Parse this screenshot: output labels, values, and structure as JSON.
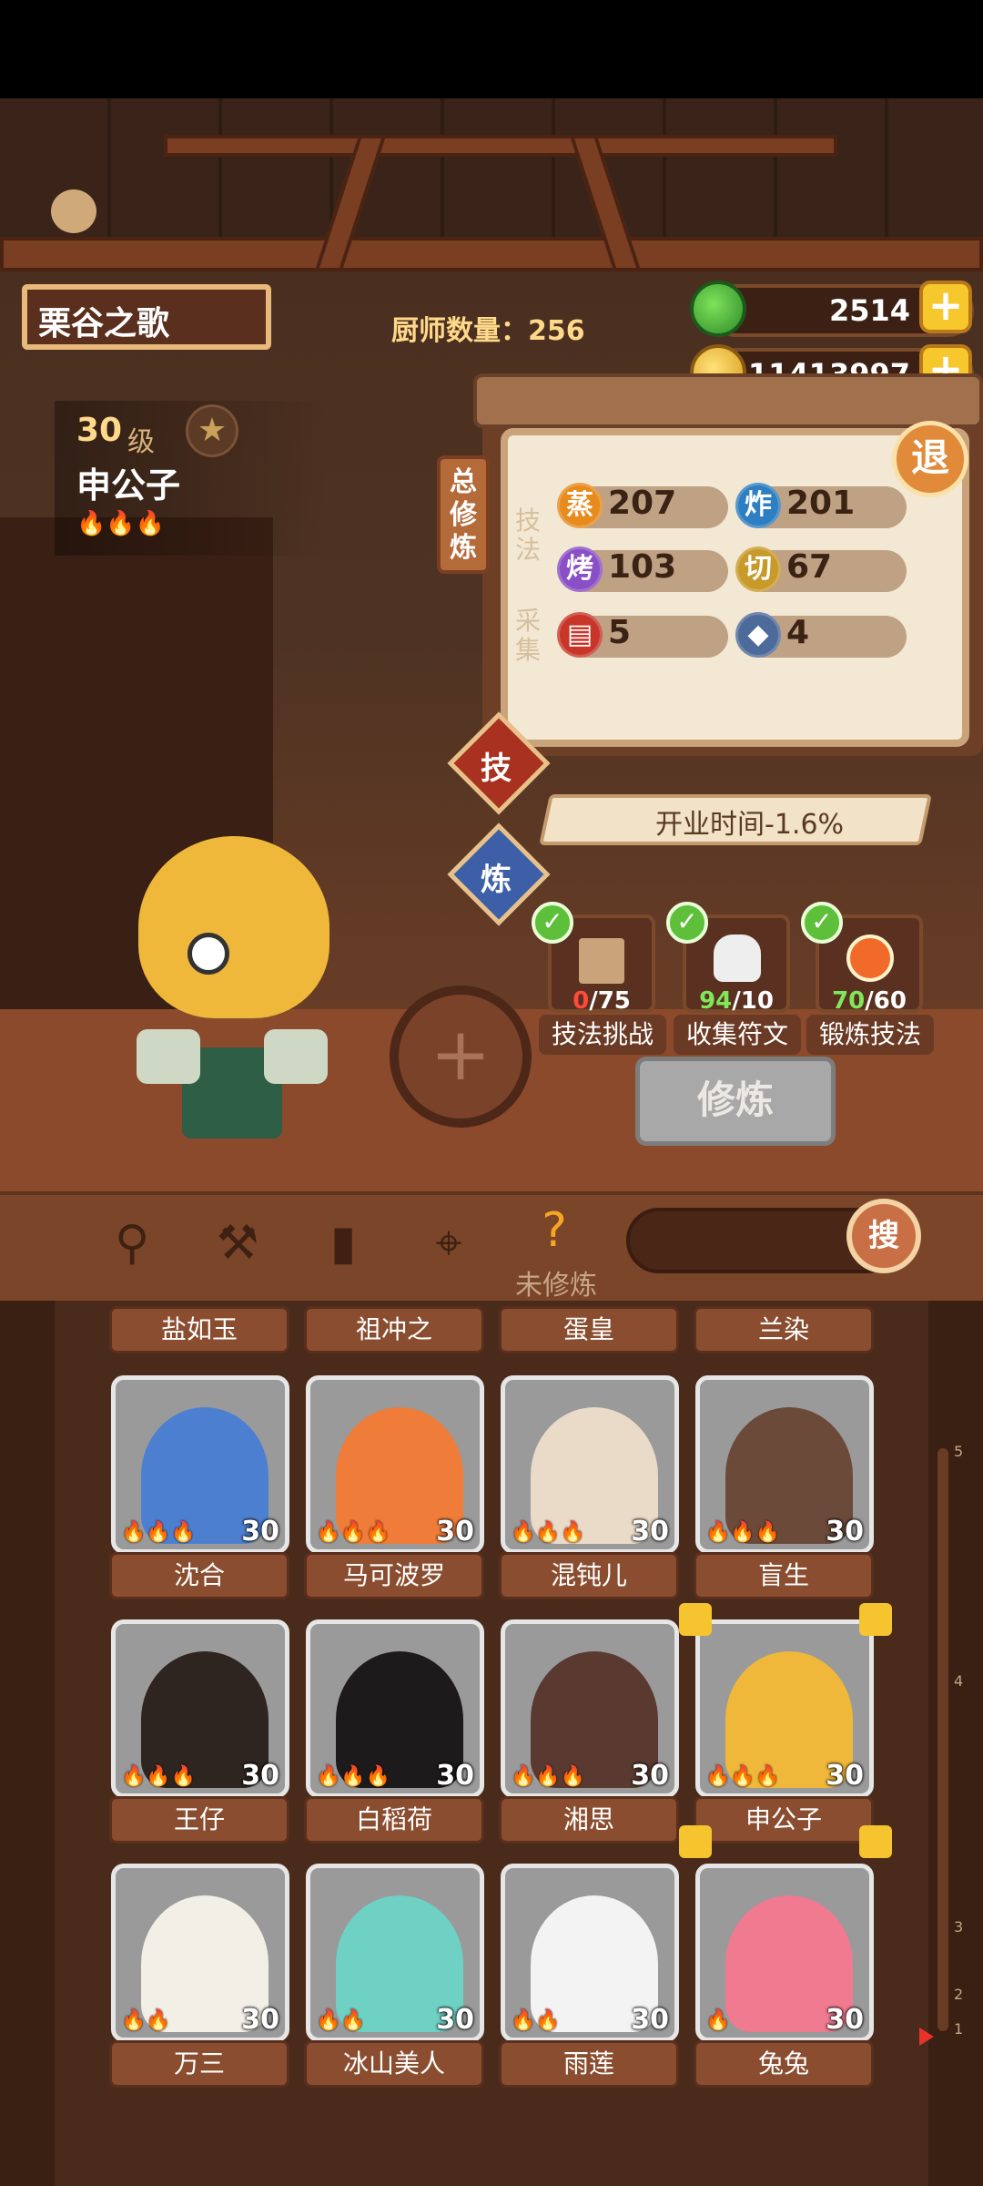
{
  "header": {
    "restaurant_name": "栗谷之歌",
    "chef_count_label": "厨师数量：256",
    "currency": {
      "jade": "2514",
      "coins": "11413997"
    }
  },
  "chef": {
    "level": "30",
    "level_unit": "级",
    "name": "申公子",
    "flames": "🔥🔥🔥"
  },
  "panel": {
    "title": "总修炼",
    "exit_label": "退",
    "section_skill": "技法",
    "section_gather": "采集",
    "stats": [
      {
        "icon": "蒸",
        "value": "207",
        "color": "#e88a1c"
      },
      {
        "icon": "炸",
        "value": "201",
        "color": "#2e7fc2"
      },
      {
        "icon": "烤",
        "value": "103",
        "color": "#8a4ec7"
      },
      {
        "icon": "切",
        "value": "67",
        "color": "#c89a2a"
      },
      {
        "icon": "",
        "value": "5",
        "color": "#c8362a"
      },
      {
        "icon": "",
        "value": "4",
        "color": "#4d6b9a"
      }
    ],
    "tab_skill": "技",
    "tab_refine": "炼",
    "business_time": "开业时间-1.6%",
    "tasks": [
      {
        "progress_a": "0",
        "progress_b": "/75",
        "label": "技法挑战",
        "color": "#ff4a3a"
      },
      {
        "progress_a": "94",
        "progress_b": "/10",
        "label": "收集符文",
        "color": "#7fe85a"
      },
      {
        "progress_a": "70",
        "progress_b": "/60",
        "label": "锻炼技法",
        "color": "#7fe85a"
      }
    ],
    "train_button": "修炼"
  },
  "filter": {
    "unfinished_label": "未修炼",
    "search_button": "搜"
  },
  "list": {
    "top_tabs": [
      "盐如玉",
      "祖冲之",
      "蛋皇",
      "兰染"
    ],
    "rows": [
      [
        {
          "name": "沈合",
          "level": "30",
          "flames": "🔥🔥🔥",
          "bg": "#4d7fd1"
        },
        {
          "name": "马可波罗",
          "level": "30",
          "flames": "🔥🔥🔥",
          "bg": "#f07c3a"
        },
        {
          "name": "混钝儿",
          "level": "30",
          "flames": "🔥🔥🔥",
          "bg": "#eadbc8"
        },
        {
          "name": "盲生",
          "level": "30",
          "flames": "🔥🔥🔥",
          "bg": "#6b4a3a"
        }
      ],
      [
        {
          "name": "王仔",
          "level": "30",
          "flames": "🔥🔥🔥",
          "bg": "#2e2420"
        },
        {
          "name": "白稻荷",
          "level": "30",
          "flames": "🔥🔥🔥",
          "bg": "#1c1a1a"
        },
        {
          "name": "湘思",
          "level": "30",
          "flames": "🔥🔥🔥",
          "bg": "#5a3a30"
        },
        {
          "name": "申公子",
          "level": "30",
          "flames": "🔥🔥🔥",
          "bg": "#f0b83a"
        }
      ],
      [
        {
          "name": "万三",
          "level": "30",
          "flames": "🔥🔥",
          "bg": "#f2efe6"
        },
        {
          "name": "冰山美人",
          "level": "30",
          "flames": "🔥🔥",
          "bg": "#6fd0c4"
        },
        {
          "name": "雨莲",
          "level": "30",
          "flames": "🔥🔥",
          "bg": "#f3f3f3"
        },
        {
          "name": "兔兔",
          "level": "30",
          "flames": "🔥",
          "bg": "#f07a90"
        }
      ]
    ],
    "scroll_marks": [
      "5",
      "4",
      "3",
      "2",
      "1"
    ]
  }
}
